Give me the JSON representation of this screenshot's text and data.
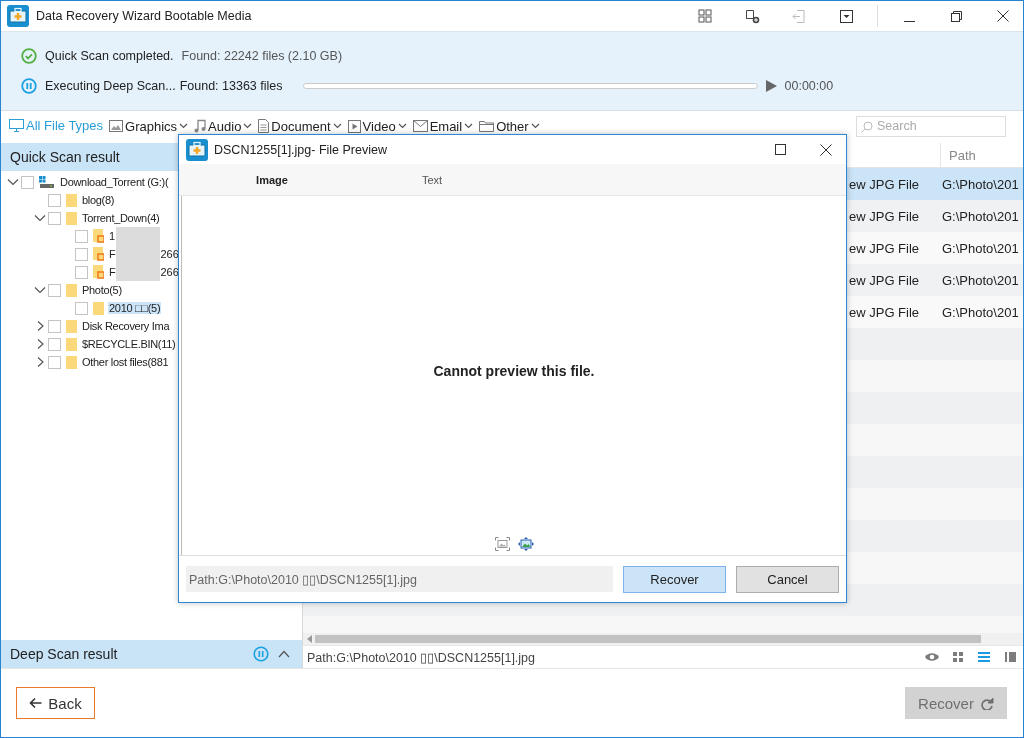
{
  "window": {
    "title": "Data Recovery Wizard Bootable Media"
  },
  "status": {
    "quick_scan": {
      "label": "Quick Scan completed.",
      "found": "Found: 22242 files (2.10 GB)"
    },
    "deep_scan": {
      "label": "Executing Deep Scan...",
      "found": "Found: 13363 files",
      "level": 0,
      "time": "00:00:00"
    }
  },
  "filters": [
    {
      "label": "All File Types",
      "selected": true,
      "dropdown": false
    },
    {
      "label": "Graphics",
      "selected": false,
      "dropdown": true
    },
    {
      "label": "Audio",
      "selected": false,
      "dropdown": true
    },
    {
      "label": "Document",
      "selected": false,
      "dropdown": true
    },
    {
      "label": "Video",
      "selected": false,
      "dropdown": true
    },
    {
      "label": "Email",
      "selected": false,
      "dropdown": true
    },
    {
      "label": "Other",
      "selected": false,
      "dropdown": true
    }
  ],
  "search": {
    "placeholder": "Search"
  },
  "quick_scan_panel": {
    "title": "Quick Scan result",
    "tree": [
      {
        "kind": "drive",
        "label": "Download_Torrent (G:)(",
        "expanded": true,
        "checked": false,
        "selected": false,
        "children": [
          {
            "kind": "folder",
            "label": "blog(8)",
            "checked": false,
            "selected": false
          },
          {
            "kind": "folder",
            "label": "Torrent_Down(4)",
            "expanded": true,
            "checked": false,
            "selected": false,
            "children": [
              {
                "kind": "file",
                "label": "1",
                "redacted": true,
                "checked": false,
                "selected": false
              },
              {
                "kind": "file",
                "label": "F",
                "label_end": "266",
                "redacted": true,
                "checked": false,
                "selected": false
              },
              {
                "kind": "file",
                "label": "F",
                "label_end": "266",
                "redacted": true,
                "checked": false,
                "selected": false
              }
            ]
          },
          {
            "kind": "folder",
            "label": "Photo(5)",
            "expanded": true,
            "checked": false,
            "selected": false,
            "children": [
              {
                "kind": "folder",
                "label": "2010 □□(5)",
                "checked": false,
                "selected": true
              }
            ]
          },
          {
            "kind": "folder",
            "label": "Disk Recovery Ima",
            "expanded": false,
            "checked": false,
            "selected": false
          },
          {
            "kind": "folder",
            "label": "$RECYCLE.BIN(11)",
            "expanded": false,
            "checked": false,
            "selected": false
          },
          {
            "kind": "folder",
            "label": "Other lost files(881",
            "expanded": false,
            "checked": false,
            "selected": false
          }
        ]
      }
    ]
  },
  "deep_scan_panel": {
    "title": "Deep Scan result",
    "expanded": true
  },
  "table": {
    "columns": [
      "Path"
    ],
    "rows": [
      {
        "column_1": "ew JPG File",
        "path": "G:\\Photo\\201",
        "selected": true
      },
      {
        "column_1": "ew JPG File",
        "path": "G:\\Photo\\201",
        "selected": false
      },
      {
        "column_1": "ew JPG File",
        "path": "G:\\Photo\\201",
        "selected": false
      },
      {
        "column_1": "ew JPG File",
        "path": "G:\\Photo\\201",
        "selected": false
      },
      {
        "column_1": "ew JPG File",
        "path": "G:\\Photo\\201",
        "selected": false
      }
    ]
  },
  "path_bar": "Path:G:\\Photo\\2010 ▯▯\\DSCN1255[1].jpg",
  "view_modes": [
    {
      "selected": false
    },
    {
      "selected": false
    },
    {
      "selected": true
    },
    {
      "selected": false
    }
  ],
  "back_button": "Back",
  "recover_button": {
    "label": "Recover",
    "disabled": true
  },
  "preview_dialog": {
    "title": "DSCN1255[1].jpg- File Preview",
    "tabs": [
      {
        "label": "Image",
        "selected": true
      },
      {
        "label": "Text",
        "selected": false
      }
    ],
    "message": "Cannot preview this file.",
    "path": "Path:G:\\Photo\\2010 ▯▯\\DSCN1255[1].jpg",
    "buttons": [
      "Recover",
      "Cancel"
    ]
  }
}
